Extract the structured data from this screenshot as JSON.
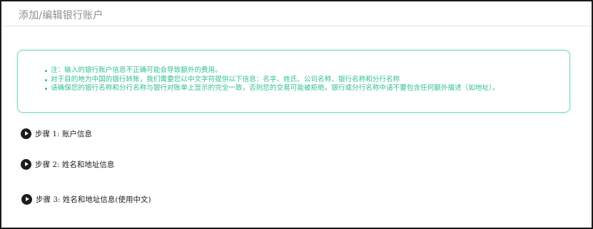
{
  "panel": {
    "title": "添加/编辑银行账户"
  },
  "notice": {
    "items": [
      "注：输入的银行账户信息不正确可能会导致额外的费用。",
      "对于目的地为中国的银行转账，我们需要您以中文字符提供以下信息：名字、姓氏、公司名称、银行名称和分行名称",
      "请确保您的银行名称和分行名称与银行对账单上显示的完全一致，否则您的交易可能被拒绝。银行或分行名称中请不要包含任何额外描述（如地址）。"
    ],
    "color": "#2fc18c",
    "border_color": "#7fdcbb"
  },
  "steps": [
    {
      "label": "步骤 1: 账户信息",
      "icon": "play-circle-icon"
    },
    {
      "label": "步骤 2: 姓名和地址信息",
      "icon": "play-circle-icon"
    },
    {
      "label": "步骤 3: 姓名和地址信息(使用中文)",
      "icon": "play-circle-icon"
    }
  ]
}
